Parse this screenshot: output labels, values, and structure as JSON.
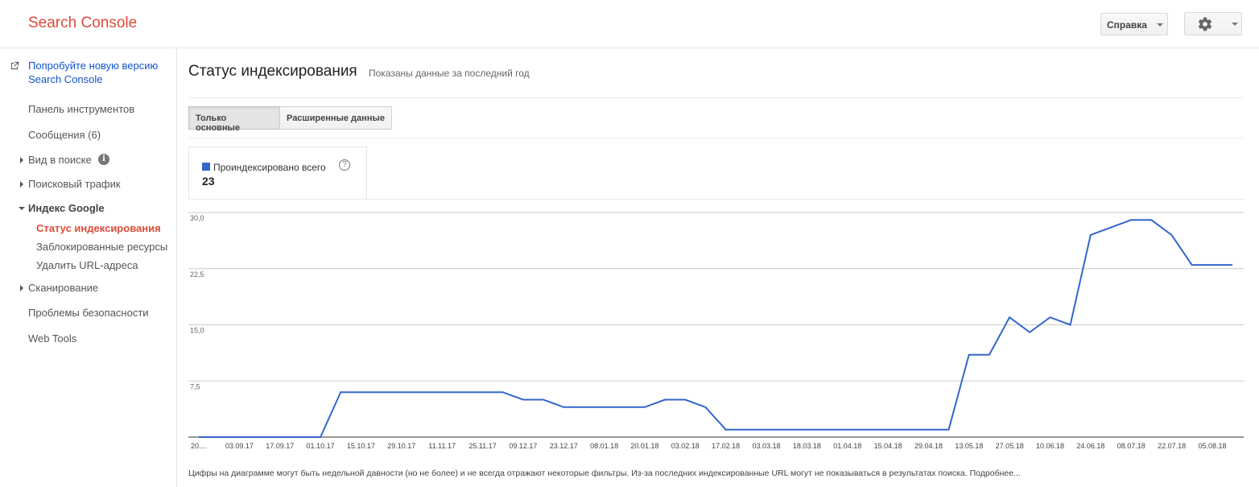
{
  "header": {
    "logo": "Search Console",
    "help_label": "Справка",
    "settings_icon": "gear-icon"
  },
  "sidebar": {
    "try_new": "Попробуйте новую версию Search Console",
    "items": [
      {
        "label": "Панель инструментов"
      },
      {
        "label": "Сообщения (6)"
      },
      {
        "label": "Вид в поиске"
      },
      {
        "label": "Поисковый трафик"
      },
      {
        "label": "Индекс Google"
      },
      {
        "label": "Статус индексирования"
      },
      {
        "label": "Заблокированные ресурсы"
      },
      {
        "label": "Удалить URL-адреса"
      },
      {
        "label": "Сканирование"
      },
      {
        "label": "Проблемы безопасности"
      },
      {
        "label": "Web Tools"
      }
    ]
  },
  "main": {
    "title": "Статус индексирования",
    "subtitle": "Показаны данные за последний год",
    "tabs": [
      {
        "label": "Только основные",
        "active": true
      },
      {
        "label": "Расширенные данные",
        "active": false
      }
    ],
    "legend": {
      "label": "Проиндексировано всего",
      "value": "23",
      "color": "#3366cc"
    },
    "footnote": "Цифры на диаграмме могут быть недельной давности (но не более) и не всегда отражают некоторые фильтры. Из-за последних индексированные URL могут не показываться в результатах поиска. Подробнее..."
  },
  "chart_data": {
    "type": "line",
    "ylim": [
      0,
      30
    ],
    "yticks": [
      "30,0",
      "22,5",
      "15,0",
      "7,5"
    ],
    "ytick_values": [
      30,
      22.5,
      15,
      7.5
    ],
    "xticks": [
      "20....",
      "03.09.17",
      "17.09.17",
      "01.10.17",
      "15.10.17",
      "29.10.17",
      "11.11.17",
      "25.11.17",
      "09.12.17",
      "23.12.17",
      "08.01.18",
      "20.01.18",
      "03.02.18",
      "17.02.18",
      "03.03.18",
      "18.03.18",
      "01.04.18",
      "15.04.18",
      "29.04.18",
      "13.05.18",
      "27.05.18",
      "10.06.18",
      "24.06.18",
      "08.07.18",
      "22.07.18",
      "05.08.18"
    ],
    "series": [
      {
        "color": "#3366cc",
        "values": [
          0,
          0,
          0,
          0,
          0,
          0,
          0,
          6,
          6,
          6,
          6,
          6,
          6,
          6,
          6,
          6,
          5,
          5,
          4,
          4,
          4,
          4,
          4,
          5,
          5,
          4,
          1,
          1,
          1,
          1,
          1,
          1,
          1,
          1,
          1,
          1,
          1,
          1,
          11,
          11,
          16,
          14,
          16,
          15,
          27,
          28,
          29,
          29,
          27,
          23,
          23,
          23
        ]
      }
    ]
  }
}
